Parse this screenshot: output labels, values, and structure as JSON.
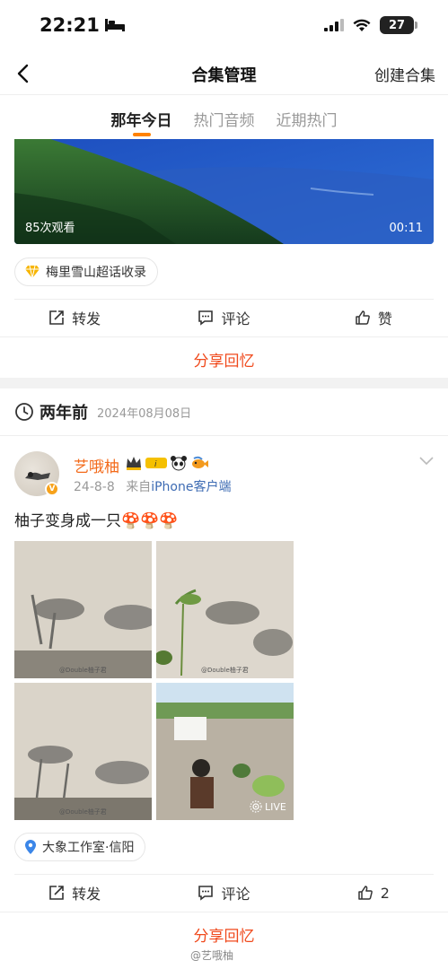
{
  "status": {
    "time": "22:21",
    "battery": "27"
  },
  "nav": {
    "title": "合集管理",
    "right_action": "创建合集"
  },
  "tabs": [
    {
      "label": "那年今日",
      "active": true
    },
    {
      "label": "热门音频",
      "active": false
    },
    {
      "label": "近期热门",
      "active": false
    }
  ],
  "post1": {
    "video_views": "85次观看",
    "video_duration": "00:11",
    "topic_chip": "梅里雪山超话收录",
    "actions": {
      "repost": "转发",
      "comment": "评论",
      "like": "赞"
    },
    "share": "分享回忆"
  },
  "section": {
    "title": "两年前",
    "date": "2024年08月08日"
  },
  "post2": {
    "username": "艺哦柚",
    "date": "24-8-8",
    "from_prefix": "来自",
    "source": "iPhone客户端",
    "text": "柚子变身成一只🍄🍄🍄",
    "watermark": "@Double柚子君",
    "live_label": "LIVE",
    "location": "大象工作室·信阳",
    "actions": {
      "repost": "转发",
      "comment": "评论",
      "like": "2"
    },
    "share": "分享回忆"
  },
  "footer_watermark": "@艺哦柚",
  "colors": {
    "accent": "#ff8200",
    "share_red": "#f04a1d",
    "username_orange": "#f36a1a",
    "link_blue": "#3d6bb3"
  }
}
